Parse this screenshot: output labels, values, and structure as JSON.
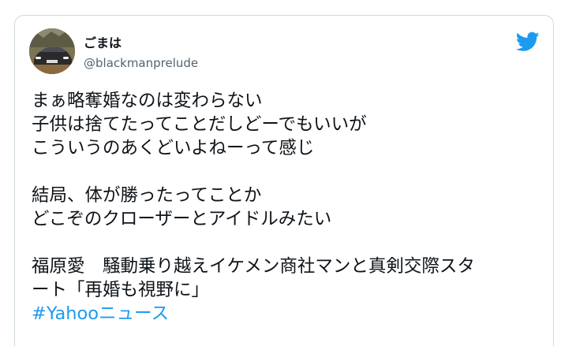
{
  "tweet": {
    "display_name": "ごまは",
    "handle": "@blackmanprelude",
    "icons": {
      "logo": "twitter-bird-icon",
      "logo_color": "#1d9bf0"
    },
    "lines": [
      "まぁ略奪婚なのは変わらない",
      "子供は捨てたってことだしどーでもいいが",
      "こういうのあくどいよねーって感じ",
      "",
      "結局、体が勝ったってことか",
      "どこぞのクローザーとアイドルみたい",
      "",
      "福原愛　騒動乗り越えイケメン商社マンと真剣交際スタ",
      "ート「再婚も視野に」"
    ],
    "hashtag": "#Yahooニュース"
  },
  "colors": {
    "text": "#0f1419",
    "secondary": "#536471",
    "link": "#1d9bf0",
    "border": "#cfd9de"
  }
}
